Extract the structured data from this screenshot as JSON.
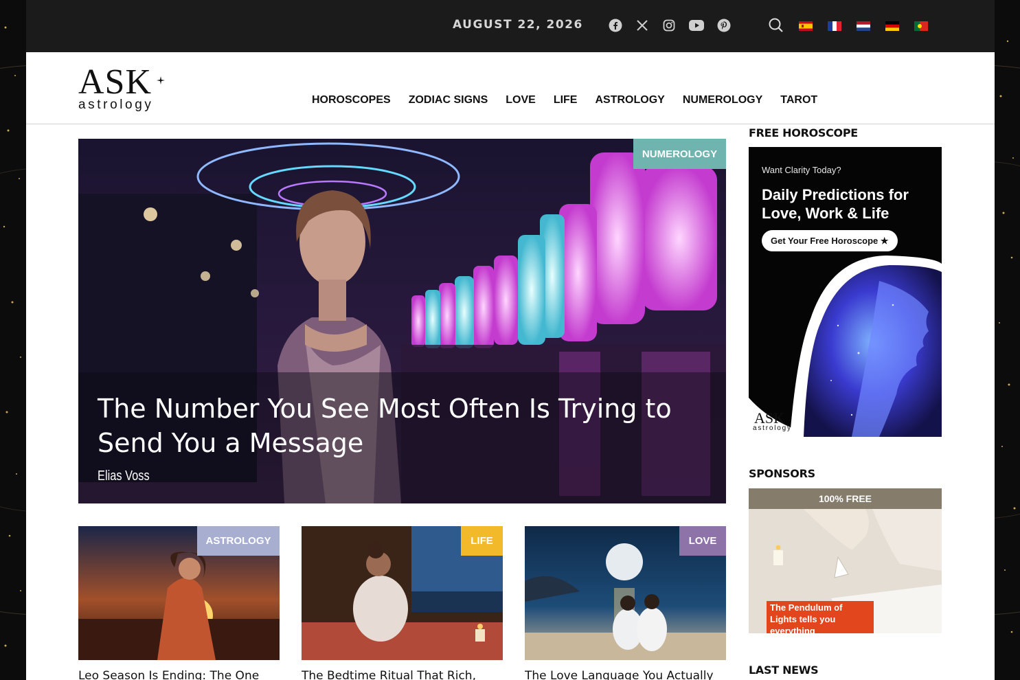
{
  "topbar": {
    "date": "AUGUST 22, 2026",
    "social_icons": [
      "facebook-icon",
      "x-icon",
      "instagram-icon",
      "youtube-icon",
      "pinterest-icon"
    ],
    "search_icon": "search-icon",
    "languages": [
      "es",
      "fr",
      "nl",
      "de",
      "pt"
    ]
  },
  "logo": {
    "word": "ASK",
    "sub": "astrology"
  },
  "nav": {
    "items": [
      {
        "label": "HOROSCOPES"
      },
      {
        "label": "ZODIAC SIGNS"
      },
      {
        "label": "LOVE"
      },
      {
        "label": "LIFE"
      },
      {
        "label": "ASTROLOGY"
      },
      {
        "label": "NUMEROLOGY"
      },
      {
        "label": "TAROT"
      }
    ]
  },
  "hero": {
    "category": "NUMEROLOGY",
    "category_color": "#6fb4ae",
    "title": "The Number You See Most Often Is Trying to Send You a Message",
    "author": "Elias Voss"
  },
  "cards": [
    {
      "category": "ASTROLOGY",
      "category_color": "#a8aed0",
      "title": "Leo Season Is Ending: The One"
    },
    {
      "category": "LIFE",
      "category_color": "#f2b92b",
      "title": "The Bedtime Ritual That Rich,"
    },
    {
      "category": "LOVE",
      "category_color": "#8e73a8",
      "title": "The Love Language You Actually"
    }
  ],
  "sidebar": {
    "free_horoscope_heading": "FREE HOROSCOPE",
    "ad": {
      "kicker": "Want Clarity Today?",
      "headline": "Daily Predictions for Love, Work & Life",
      "cta": "Get Your Free Horoscope ★",
      "logo_word": "ASK",
      "logo_sub": "astrology"
    },
    "sponsors_heading": "SPONSORS",
    "sponsor": {
      "banner": "100% FREE",
      "caption": "The Pendulum of Lights tells you everything"
    },
    "last_news_heading": "LAST NEWS"
  }
}
